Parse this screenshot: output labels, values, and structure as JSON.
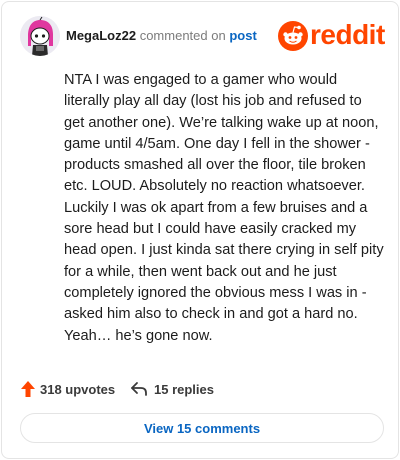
{
  "comment": {
    "username": "MegaLoz22",
    "action_text": "commented on",
    "post_link": "post",
    "body": "NTA I was engaged to a gamer who would literally play all day (lost his job and refused to get another one). We’re talking wake up at noon, game until 4/5am. One day I fell in the shower - products smashed all over the floor, tile broken etc. LOUD. Absolutely no reaction whatsoever. Luckily I was ok apart from a few bruises and a sore head but I could have easily cracked my head open. I just kinda sat there crying in self pity for a while, then went back out and he just completely ignored the obvious mess I was in - asked him also to check in and got a hard no. Yeah… he’s gone now.",
    "upvotes": "318 upvotes",
    "replies": "15 replies",
    "view_button": "View 15 comments"
  },
  "brand": {
    "wordmark": "reddit",
    "accent": "#ff4500",
    "link_color": "#0a66c2"
  },
  "icons": {
    "avatar": "snoo-avatar",
    "logo": "reddit-alien-icon",
    "upvote": "upvote-arrow-icon",
    "reply": "reply-arrow-icon"
  }
}
